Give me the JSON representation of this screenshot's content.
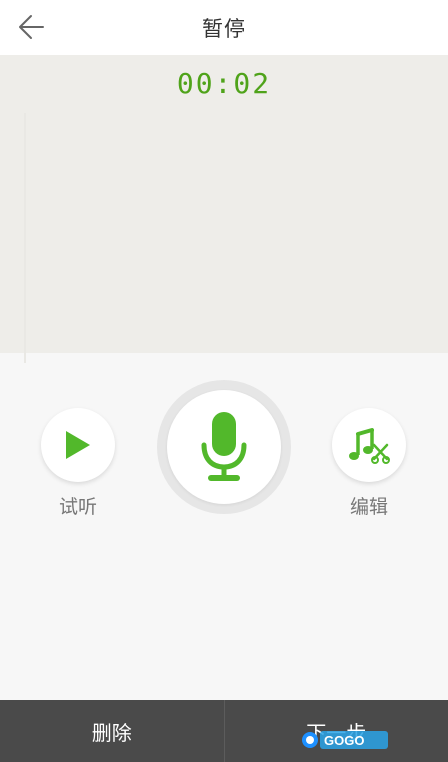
{
  "header": {
    "title": "暂停",
    "back_icon": "back-arrow-icon"
  },
  "recording": {
    "timer": "00:02"
  },
  "controls": {
    "play_label": "试听",
    "edit_label": "编辑",
    "play_icon": "play-icon",
    "mic_icon": "microphone-icon",
    "edit_icon": "music-scissors-icon"
  },
  "bottom_bar": {
    "delete_label": "删除",
    "next_label": "下一步"
  },
  "watermark": {
    "text": "GOGO"
  },
  "colors": {
    "accent": "#4fa31a",
    "icon_green": "#52b82b",
    "bottom_bar": "#4a4a4a"
  }
}
